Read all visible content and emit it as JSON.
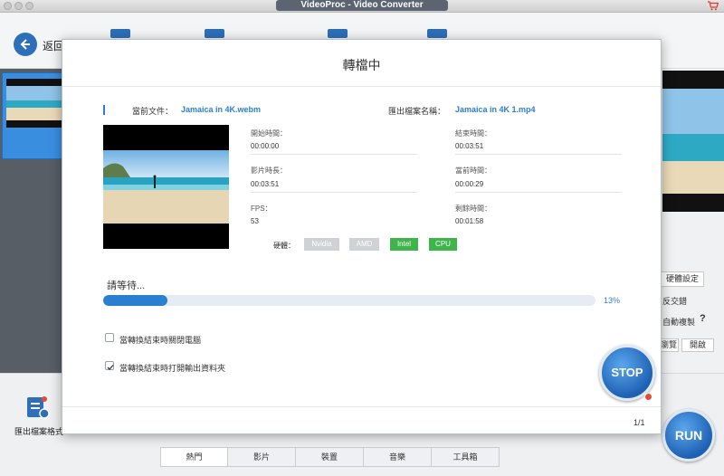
{
  "window": {
    "title": "VideoProc - Video Converter"
  },
  "app": {
    "back_label": "返回",
    "export_format_label": "匯出檔案格式",
    "right_panel": {
      "hw_settings_label": "硬體設定",
      "deinterlace_label": "反交錯",
      "auto_copy_label": "自動複製",
      "help_label": "?",
      "browse_label": "瀏覽",
      "open_label": "開啟"
    },
    "tabs": [
      "熱門",
      "影片",
      "裝置",
      "音樂",
      "工具箱"
    ],
    "run_label": "RUN"
  },
  "dialog": {
    "title": "轉檔中",
    "source_label": "當前文件：",
    "source_file": "Jamaica in 4K.webm",
    "output_label": "匯出檔案名稱：",
    "output_file": "Jamaica in 4K 1.mp4",
    "info": {
      "start_time_label": "開始時間：",
      "start_time": "00:00:00",
      "end_time_label": "結束時間：",
      "end_time": "00:03:51",
      "duration_label": "影片時長：",
      "duration": "00:03:51",
      "current_time_label": "當前時間：",
      "current_time": "00:00:29",
      "fps_label": "FPS：",
      "fps": "53",
      "remaining_label": "剩餘時間：",
      "remaining": "00:01:58"
    },
    "hardware": {
      "label": "硬體：",
      "chips": [
        {
          "name": "Nvidia",
          "active": false
        },
        {
          "name": "AMD",
          "active": false
        },
        {
          "name": "Intel",
          "active": true
        },
        {
          "name": "CPU",
          "active": true
        }
      ]
    },
    "wait_text": "請等待...",
    "progress": {
      "percent": 13,
      "label": "13%"
    },
    "options": {
      "shutdown_label": "當轉換結束時關閉電腦",
      "shutdown_checked": false,
      "open_folder_label": "當轉換結束時打開輸出資料夾",
      "open_folder_checked": true
    },
    "stop_label": "STOP",
    "page_indicator": "1/1"
  },
  "colors": {
    "accent": "#2b7fd1",
    "active_chip": "#3db54a",
    "inactive_chip": "#cfd1d4",
    "badge": "#e24a3b"
  }
}
